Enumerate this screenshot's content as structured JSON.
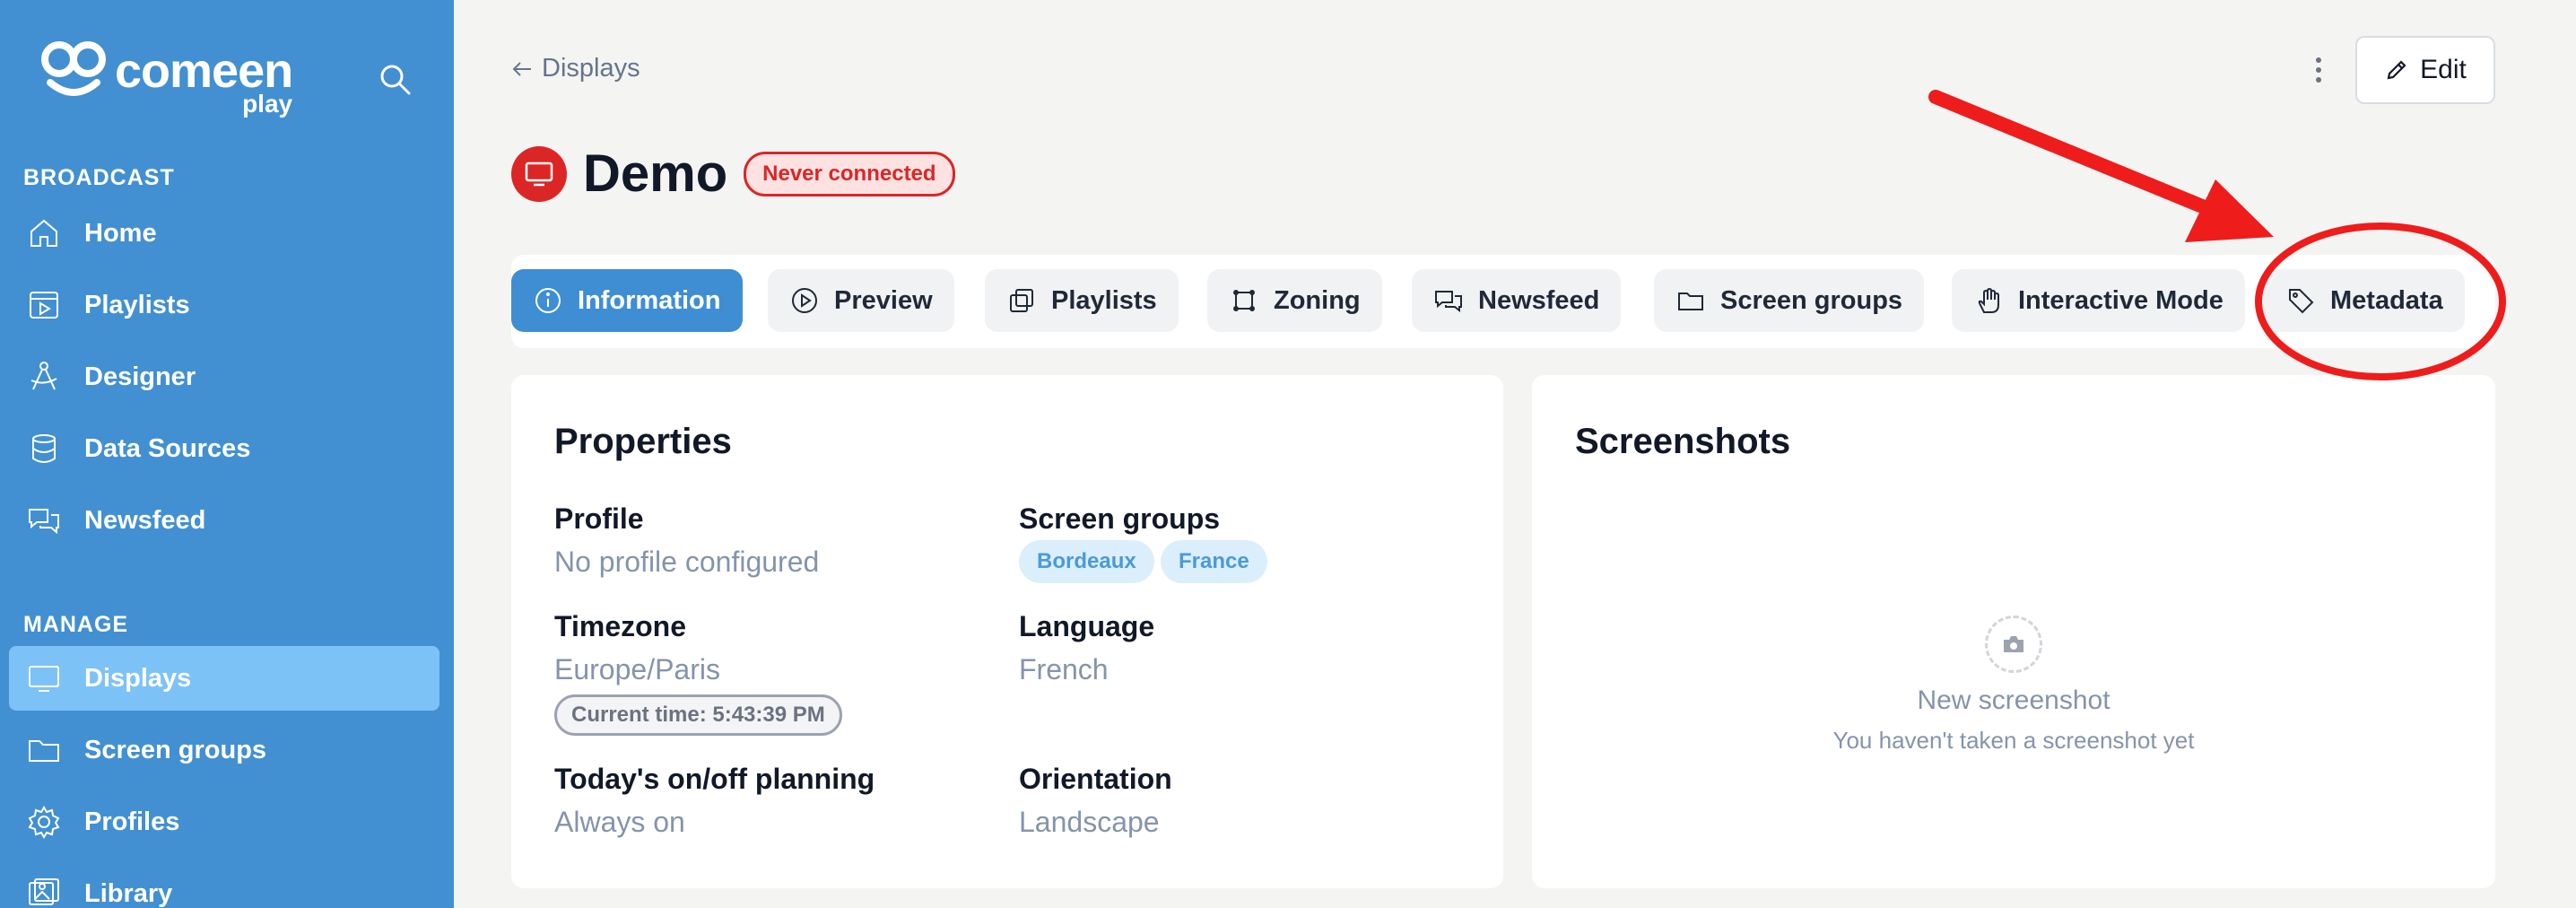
{
  "brand": {
    "name": "comeen",
    "sub": "play"
  },
  "sidebar": {
    "sections": [
      {
        "label": "BROADCAST"
      },
      {
        "label": "MANAGE"
      }
    ],
    "items": [
      {
        "label": "Home",
        "icon": "home-icon"
      },
      {
        "label": "Playlists",
        "icon": "playlist-icon"
      },
      {
        "label": "Designer",
        "icon": "designer-icon"
      },
      {
        "label": "Data Sources",
        "icon": "database-icon"
      },
      {
        "label": "Newsfeed",
        "icon": "chat-icon"
      },
      {
        "label": "Displays",
        "icon": "monitor-icon",
        "active": true
      },
      {
        "label": "Screen groups",
        "icon": "folder-icon"
      },
      {
        "label": "Profiles",
        "icon": "gear-icon"
      },
      {
        "label": "Library",
        "icon": "image-icon"
      }
    ]
  },
  "header": {
    "back_label": "Displays",
    "edit_label": "Edit",
    "title": "Demo",
    "status": "Never connected"
  },
  "tabs": [
    {
      "label": "Information",
      "icon": "info-icon",
      "active": true
    },
    {
      "label": "Preview",
      "icon": "play-icon"
    },
    {
      "label": "Playlists",
      "icon": "copy-icon"
    },
    {
      "label": "Zoning",
      "icon": "crop-icon"
    },
    {
      "label": "Newsfeed",
      "icon": "chat-icon"
    },
    {
      "label": "Screen groups",
      "icon": "folder-icon"
    },
    {
      "label": "Interactive Mode",
      "icon": "hand-icon"
    },
    {
      "label": "Metadata",
      "icon": "tag-icon"
    }
  ],
  "properties": {
    "title": "Properties",
    "profile_label": "Profile",
    "profile_value": "No profile configured",
    "groups_label": "Screen groups",
    "groups": [
      "Bordeaux",
      "France"
    ],
    "timezone_label": "Timezone",
    "timezone_value": "Europe/Paris",
    "current_time": "Current time: 5:43:39 PM",
    "language_label": "Language",
    "language_value": "French",
    "planning_label": "Today's on/off planning",
    "planning_value": "Always on",
    "orientation_label": "Orientation",
    "orientation_value": "Landscape"
  },
  "screenshots": {
    "title": "Screenshots",
    "empty_title": "New screenshot",
    "empty_sub": "You haven't taken a screenshot yet"
  },
  "colors": {
    "sidebar": "#4290d1",
    "active_nav": "#7dc2f6",
    "active_tab": "#3f8ed4",
    "danger": "#dc2626",
    "annotation": "#ef1c1c"
  }
}
